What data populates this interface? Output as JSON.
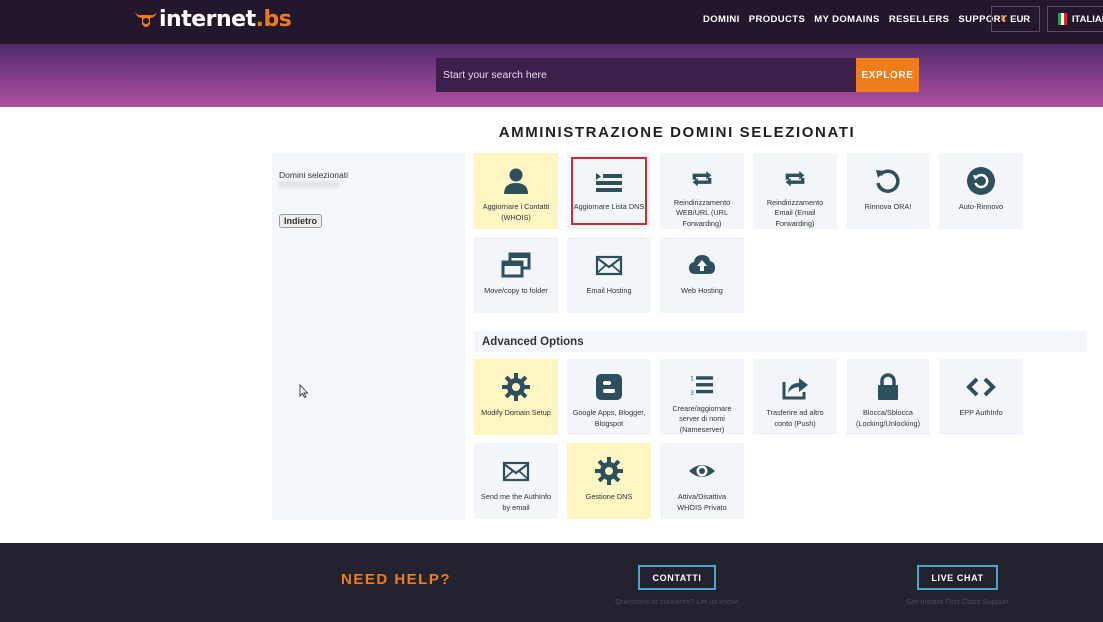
{
  "brand": {
    "name_main": "internet",
    "name_suffix": ".bs",
    "accent": "#f07c1c",
    "dark": "#22172d"
  },
  "nav": {
    "items": [
      "DOMINI",
      "PRODUCTS",
      "MY DOMAINS",
      "RESELLERS",
      "SUPPORT"
    ]
  },
  "currency": {
    "symbol": "€",
    "label": "EUR"
  },
  "language": {
    "label": "ITALIANO"
  },
  "search": {
    "placeholder": "Start your search here",
    "button": "EXPLORE"
  },
  "page": {
    "title": "AMMINISTRAZIONE DOMINI SELEZIONATI"
  },
  "sidebar": {
    "label": "Domini selezionati",
    "back": "Indietro"
  },
  "tiles": [
    {
      "label": "Aggiornare i Contatti (WHOIS)",
      "icon": "user-icon",
      "highlight": true
    },
    {
      "label": "Aggiornare Lista DNS",
      "icon": "list-icon",
      "selected": true
    },
    {
      "label": "Reindirizzamento WEB/URL (URL Forwarding)",
      "icon": "retweet-icon"
    },
    {
      "label": "Reindirizzamento Email (Email Forwarding)",
      "icon": "retweet-icon"
    },
    {
      "label": "Rinnova ORA!",
      "icon": "undo-icon"
    },
    {
      "label": "Auto-Rinnovo",
      "icon": "auto-renew-icon"
    },
    {
      "label": "Move/copy to folder",
      "icon": "windows-icon"
    },
    {
      "label": "Email Hosting",
      "icon": "envelope-icon"
    },
    {
      "label": "Web Hosting",
      "icon": "cloud-upload-icon"
    }
  ],
  "advanced": {
    "title": "Advanced Options",
    "tiles": [
      {
        "label": "Modify Domain Setup",
        "icon": "gear-icon",
        "highlight": true
      },
      {
        "label": "Google Apps, Blogger, Blogspot",
        "icon": "blogger-icon"
      },
      {
        "label": "Creare/aggiornare server di nomi (Nameserver)",
        "icon": "numbered-list-icon"
      },
      {
        "label": "Trasferire ad altro conto (Push)",
        "icon": "share-icon"
      },
      {
        "label": "Blocca/Sblocca (Locking/Unlocking)",
        "icon": "lock-icon"
      },
      {
        "label": "EPP AuthInfo",
        "icon": "code-icon"
      },
      {
        "label": "Send me the AuthInfo by email",
        "icon": "envelope-icon"
      },
      {
        "label": "Gestione DNS",
        "icon": "gear-icon",
        "highlight": true
      },
      {
        "label": "Attiva/Disattiva WHOIS Privato",
        "icon": "eye-icon"
      }
    ]
  },
  "footer": {
    "help": "NEED HELP?",
    "contact_button": "CONTATTI",
    "contact_sub": "Questions or concerns? Let us know!",
    "chat_button": "LIVE CHAT",
    "chat_sub": "Get Instant First Class Support"
  }
}
